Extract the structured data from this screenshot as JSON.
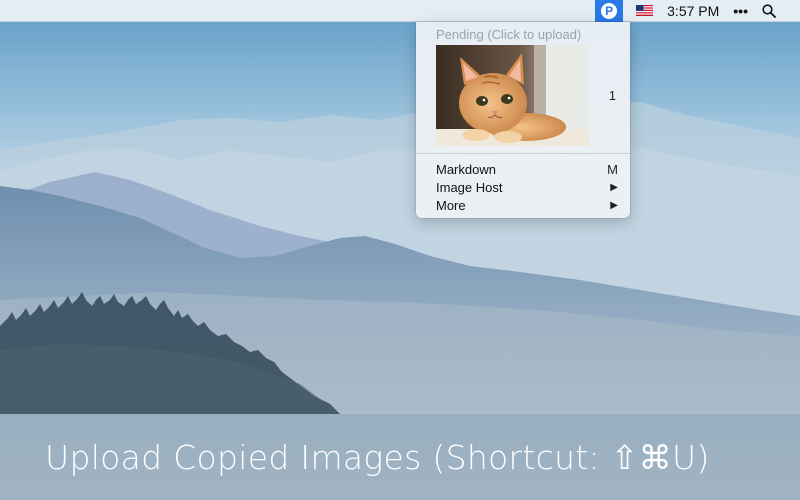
{
  "menubar": {
    "app_icon": "p-circle-logo",
    "app_logo_letter": "P",
    "flag_icon": "us-flag-icon",
    "clock": "3:57 PM",
    "overflow_label": "•••",
    "search_icon": "magnifier-icon"
  },
  "status_menu": {
    "header": "Pending (Click to upload)",
    "pending_items": [
      {
        "thumbnail": "kitten-photo",
        "count": "1"
      }
    ],
    "items": [
      {
        "label": "Markdown",
        "accessory": "M"
      },
      {
        "label": "Image Host",
        "accessory": "▶"
      },
      {
        "label": "More",
        "accessory": "▶"
      }
    ]
  },
  "caption": "Upload Copied Images (Shortcut: ⇧⌘U)",
  "colors": {
    "accent": "#2a79e6",
    "sky_top": "#5f9cc6",
    "sky_bottom": "#dde6ec",
    "caption_text": "#ffffff"
  }
}
